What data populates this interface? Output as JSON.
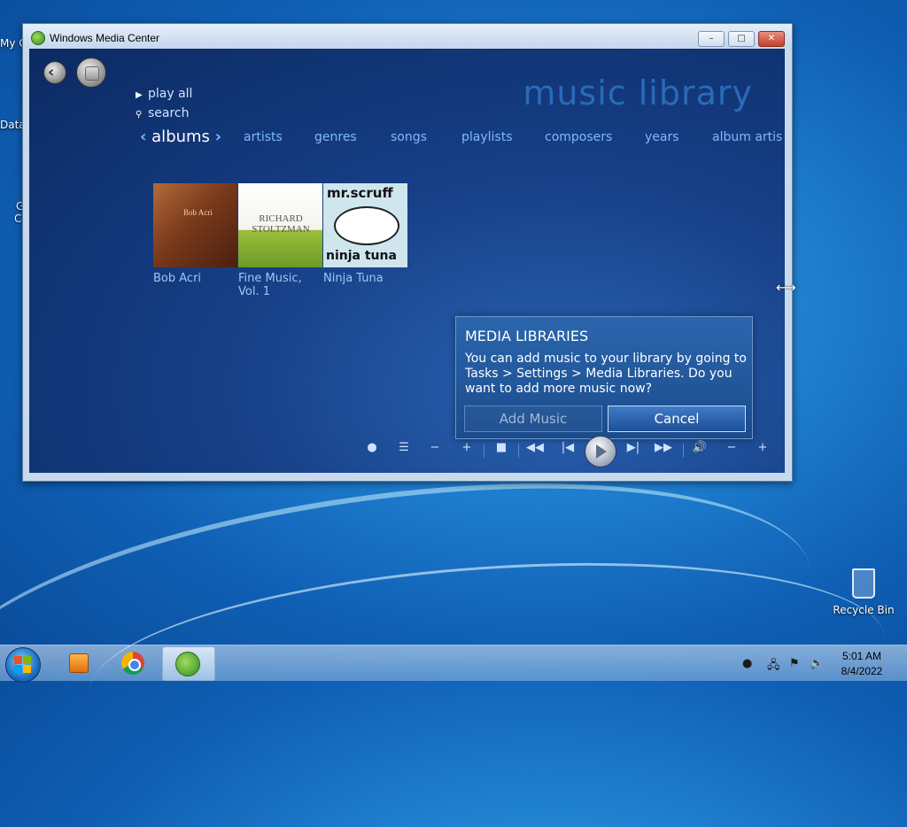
{
  "desktop": {
    "icons": [
      {
        "label": "My C"
      },
      {
        "label": "Data"
      },
      {
        "label": "G"
      },
      {
        "label": "C"
      }
    ],
    "recycle_bin_label": "Recycle Bin"
  },
  "window": {
    "title": "Windows Media Center",
    "min_label": "–",
    "max_label": "□",
    "close_label": "✕"
  },
  "wmc": {
    "back_label": "‹",
    "library_title": "music library",
    "menu": {
      "play_all": "play all",
      "search": "search"
    },
    "tabs": [
      {
        "label": "albums"
      },
      {
        "label": "artists"
      },
      {
        "label": "genres"
      },
      {
        "label": "songs"
      },
      {
        "label": "playlists"
      },
      {
        "label": "composers"
      },
      {
        "label": "years"
      },
      {
        "label": "album artis"
      }
    ],
    "albums": [
      {
        "name": "Bob Acri",
        "cover_text": "Bob Acri"
      },
      {
        "name": "Fine Music, Vol. 1",
        "cover_text": "RICHARD STOLTZMAN"
      },
      {
        "name": "Ninja Tuna",
        "cover_text": "mr.scruff",
        "cover_text2": "ninja tuna"
      }
    ],
    "dialog": {
      "title": "MEDIA LIBRARIES",
      "message": "You can add music to your library by going to Tasks > Settings > Media Libraries. Do you want to add more music now?",
      "add_button": "Add Music",
      "cancel_button": "Cancel"
    },
    "controls": {
      "record": "●",
      "list": "☰",
      "minus1": "−",
      "plus1": "+",
      "stop": "■",
      "rewind": "◀◀",
      "prev": "|◀",
      "next": "▶|",
      "ffwd": "▶▶",
      "volume": "🔊",
      "vol_down": "−",
      "vol_up": "+"
    }
  },
  "taskbar": {
    "time": "5:01 AM",
    "date": "8/4/2022"
  },
  "colors": {
    "accent": "#7fb8ff",
    "wmc_bg": "#163f86"
  }
}
